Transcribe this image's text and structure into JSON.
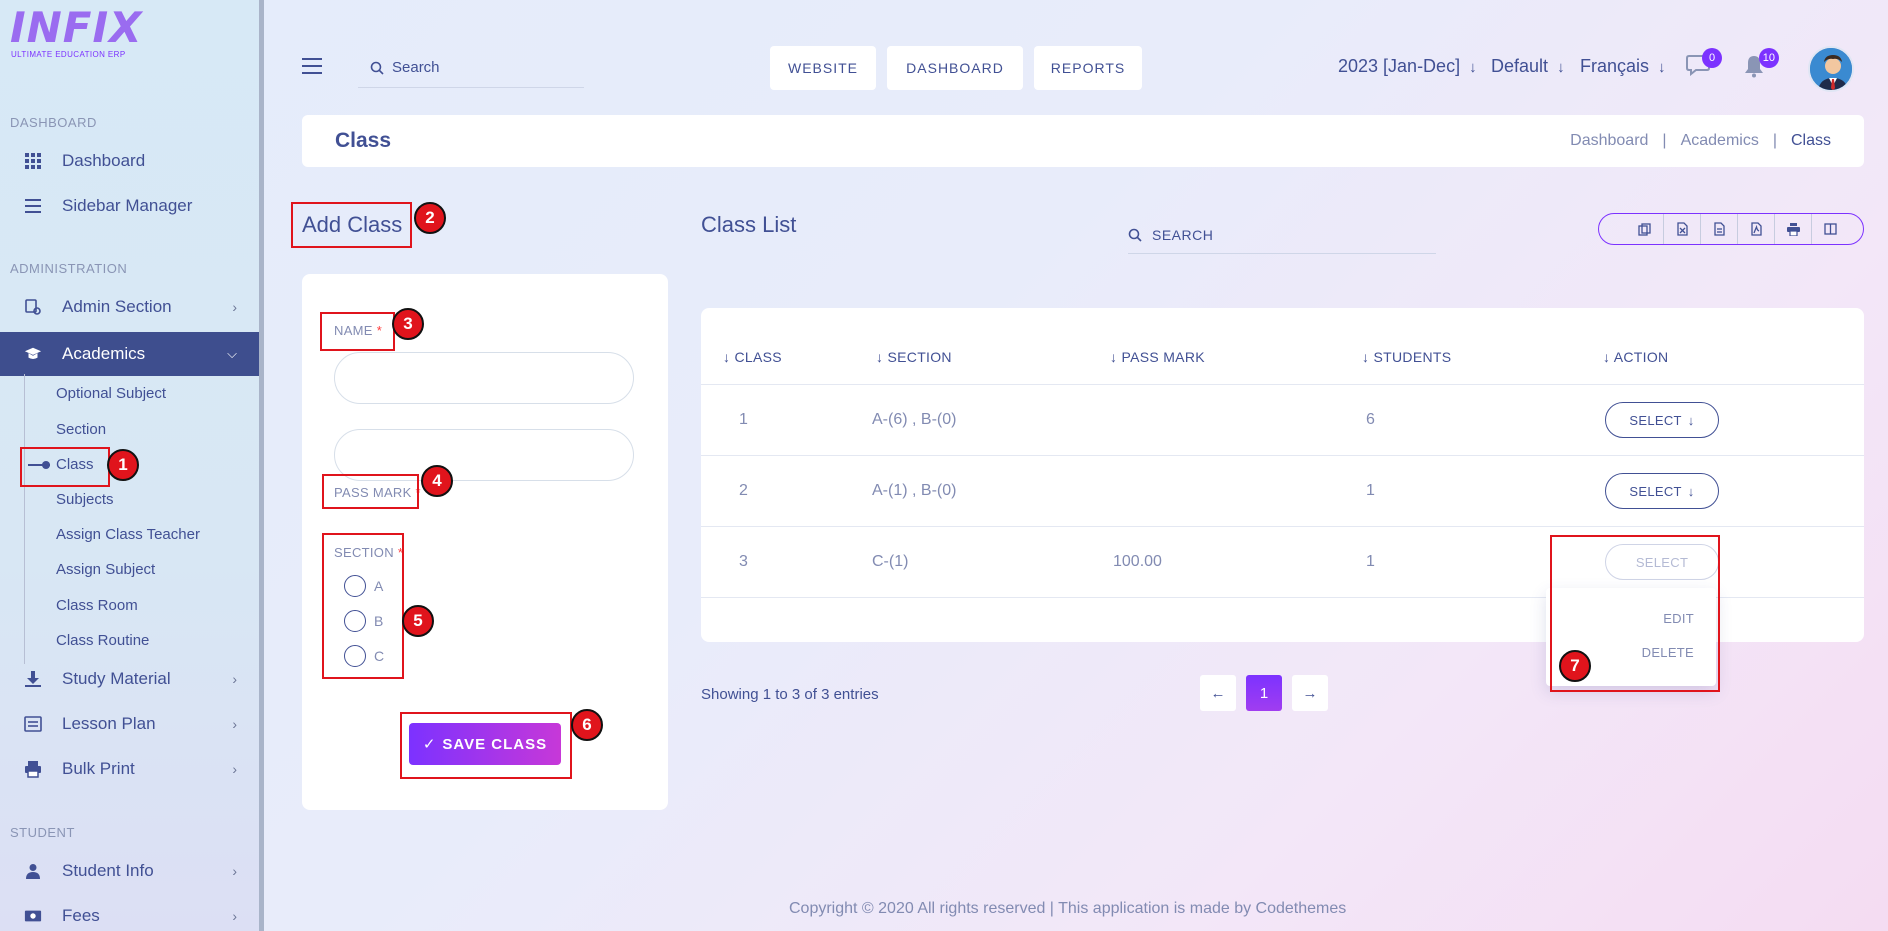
{
  "brand": {
    "logo_text": "INFIX",
    "logo_subtitle": "ULTIMATE EDUCATION ERP"
  },
  "sidebar": {
    "sections": {
      "dashboard": "DASHBOARD",
      "administration": "ADMINISTRATION",
      "student": "STUDENT"
    },
    "items": [
      {
        "label": "Dashboard",
        "icon": "grid-icon"
      },
      {
        "label": "Sidebar Manager",
        "icon": "menu-lines-icon"
      },
      {
        "label": "Admin Section",
        "icon": "admin-settings-icon"
      },
      {
        "label": "Academics",
        "icon": "graduation-cap-icon"
      },
      {
        "label": "Study Material",
        "icon": "download-icon"
      },
      {
        "label": "Lesson Plan",
        "icon": "list-icon"
      },
      {
        "label": "Bulk Print",
        "icon": "printer-icon"
      },
      {
        "label": "Student Info",
        "icon": "user-icon"
      },
      {
        "label": "Fees",
        "icon": "money-icon"
      }
    ],
    "academics_sub": [
      "Optional Subject",
      "Section",
      "Class",
      "Subjects",
      "Assign Class Teacher",
      "Assign Subject",
      "Class Room",
      "Class Routine"
    ]
  },
  "topbar": {
    "search_placeholder": "Search",
    "buttons": [
      "WEBSITE",
      "DASHBOARD",
      "REPORTS"
    ],
    "session": "2023 [Jan-Dec]",
    "style": "Default",
    "language": "Français",
    "message_count": "0",
    "notification_count": "10"
  },
  "page": {
    "title": "Class",
    "breadcrumb": [
      "Dashboard",
      "Academics",
      "Class"
    ]
  },
  "form": {
    "title": "Add Class",
    "name_label": "NAME",
    "pass_mark_label": "PASS MARK",
    "section_label": "SECTION",
    "required_mark": "*",
    "sections": [
      "A",
      "B",
      "C"
    ],
    "save_label": "SAVE CLASS",
    "save_check": "✓"
  },
  "list": {
    "title": "Class List",
    "search_placeholder": "SEARCH",
    "columns": [
      "CLASS",
      "SECTION",
      "PASS MARK",
      "STUDENTS",
      "ACTION"
    ],
    "rows": [
      {
        "class": "1",
        "section": "A-(6) , B-(0)",
        "pass_mark": "",
        "students": "6",
        "action": "SELECT"
      },
      {
        "class": "2",
        "section": "A-(1) , B-(0)",
        "pass_mark": "",
        "students": "1",
        "action": "SELECT"
      },
      {
        "class": "3",
        "section": "C-(1)",
        "pass_mark": "100.00",
        "students": "1",
        "action": "SELECT"
      }
    ],
    "dropdown": [
      "EDIT",
      "DELETE"
    ],
    "showing": "Showing 1 to 3 of 3 entries",
    "page": "1",
    "prev": "←",
    "next": "→",
    "export_icons": [
      "copy-icon",
      "excel-icon",
      "csv-icon",
      "pdf-icon",
      "print-icon",
      "columns-icon"
    ]
  },
  "footer": {
    "text": "Copyright © 2020 All rights reserved | This application is made by Codethemes"
  },
  "annotations": [
    "1",
    "2",
    "3",
    "4",
    "5",
    "6",
    "7"
  ],
  "colors": {
    "primary": "#415094",
    "accent": "#7c32ff",
    "callout": "#e0141c"
  }
}
